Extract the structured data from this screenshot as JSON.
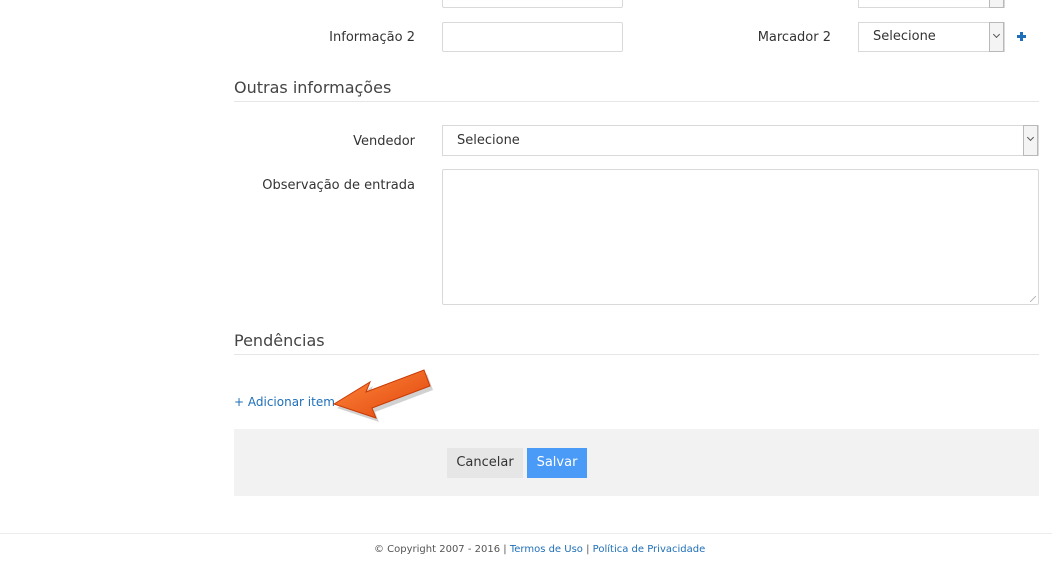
{
  "form": {
    "info2_label": "Informação 2",
    "marker2_label": "Marcador 2",
    "marker2_value": "Selecione",
    "other_info_title": "Outras informações",
    "seller_label": "Vendedor",
    "seller_value": "Selecione",
    "entry_note_label": "Observação de entrada",
    "pending_title": "Pendências",
    "add_item_link": "+ Adicionar item"
  },
  "actions": {
    "cancel_label": "Cancelar",
    "save_label": "Salvar"
  },
  "footer": {
    "copyright": "© Copyright 2007 - 2016",
    "sep1": "|",
    "terms_link": "Termos de Uso",
    "sep2": "|",
    "privacy_link": "Política de Privacidade"
  },
  "icons": {
    "add_marker": "plus-icon",
    "annotation_arrow": "arrow-pointer-icon",
    "dropdown": "chevron-down-icon"
  },
  "colors": {
    "link": "#1f6fb8",
    "save_button": "#4a9bf7",
    "cancel_button": "#e6e6e6",
    "arrow": "#f05a10",
    "footer_bar": "#f2f2f2"
  }
}
